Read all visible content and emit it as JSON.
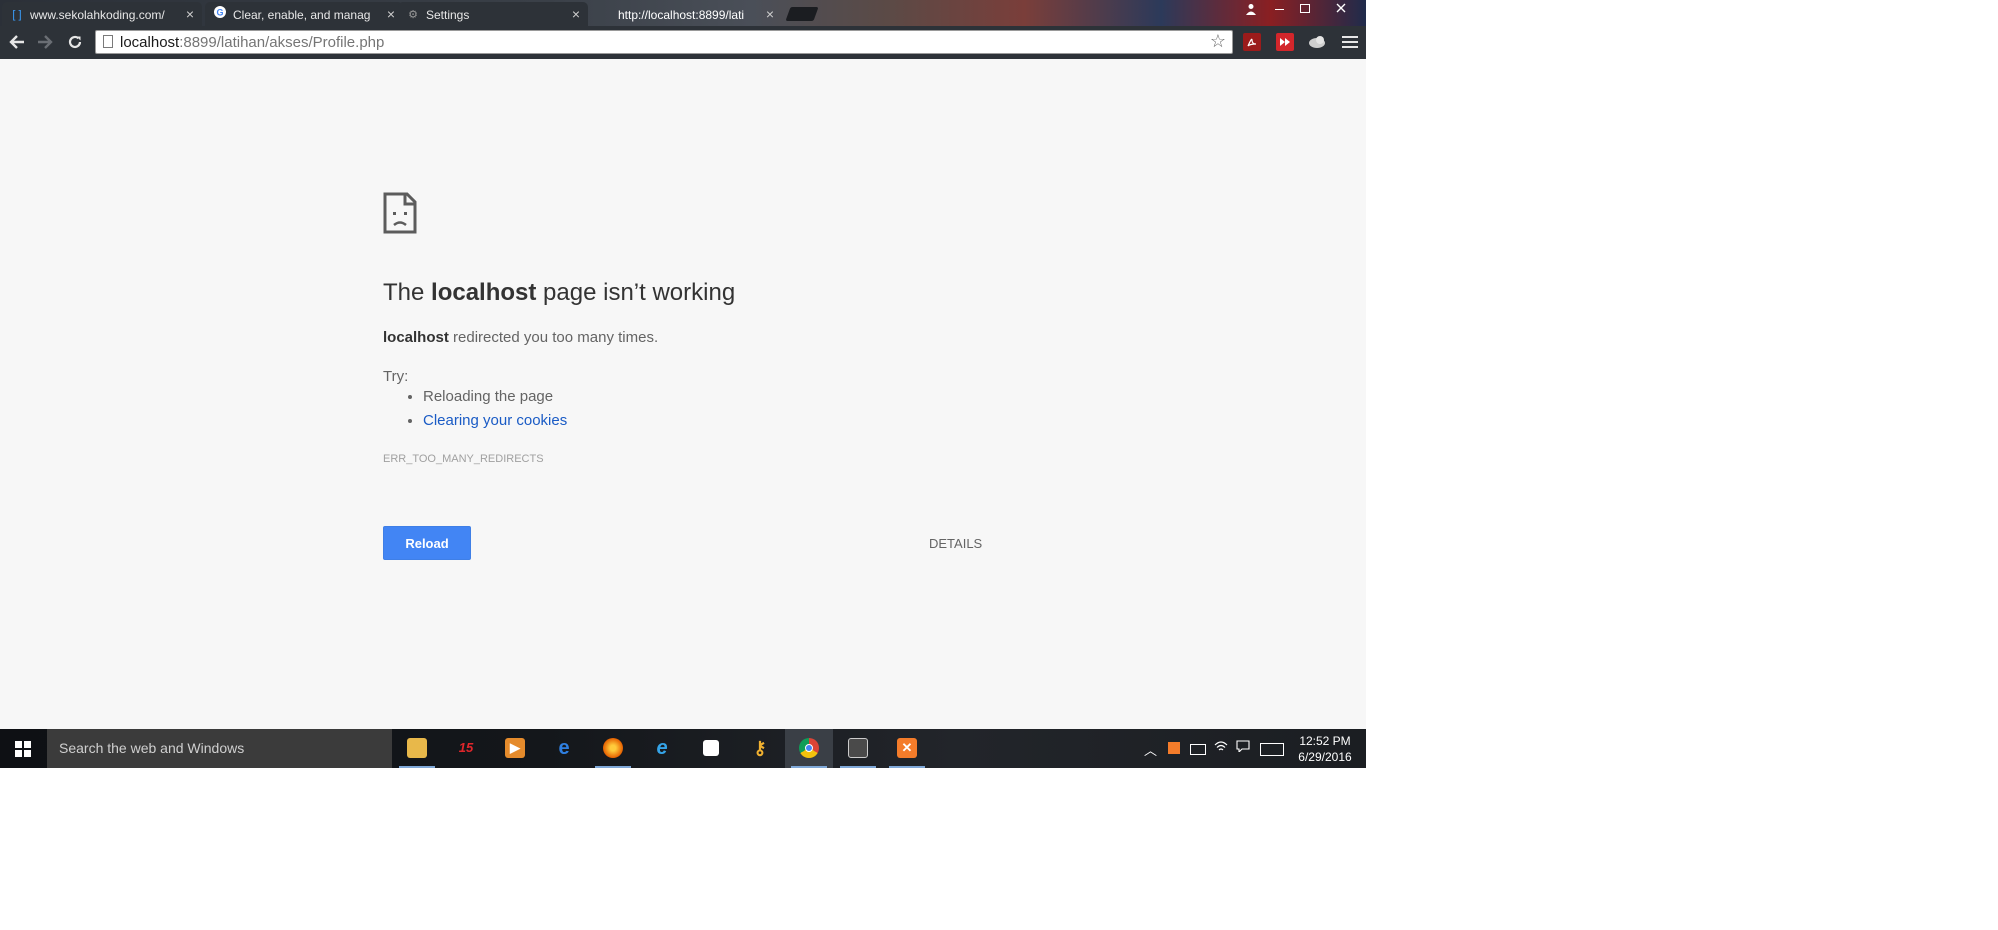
{
  "browser": {
    "tabs": [
      {
        "title": "www.sekolahkoding.com/",
        "favicon": "bracket-favicon-icon",
        "active": false
      },
      {
        "title": "Clear, enable, and manag",
        "favicon": "google-favicon-icon",
        "active": false
      },
      {
        "title": "Settings",
        "favicon": "gear-icon",
        "active": false
      },
      {
        "title": "http://localhost:8899/lati",
        "favicon": "",
        "active": true
      }
    ],
    "close_glyph": "×",
    "address": {
      "host": "localhost",
      "path": ":8899/latihan/akses/Profile.php"
    }
  },
  "error_page": {
    "title_prefix": "The ",
    "title_host": "localhost",
    "title_suffix": " page isn’t working",
    "desc_host": "localhost",
    "desc_text": " redirected you too many times.",
    "try_label": "Try:",
    "suggestions": [
      "Reloading the page",
      "Clearing your cookies"
    ],
    "error_code": "ERR_TOO_MANY_REDIRECTS",
    "reload_label": "Reload",
    "details_label": "DETAILS",
    "link_color": "#1a5bc5",
    "button_color": "#4285f4"
  },
  "taskbar": {
    "search_placeholder": "Search the web and Windows",
    "time": "12:52 PM",
    "date": "6/29/2016",
    "apps": [
      "file-explorer-icon",
      "app-15-icon",
      "media-player-icon",
      "edge-icon",
      "firefox-icon",
      "internet-explorer-icon",
      "store-icon",
      "keys-icon",
      "chrome-icon",
      "sublime-icon",
      "xampp-icon"
    ]
  }
}
